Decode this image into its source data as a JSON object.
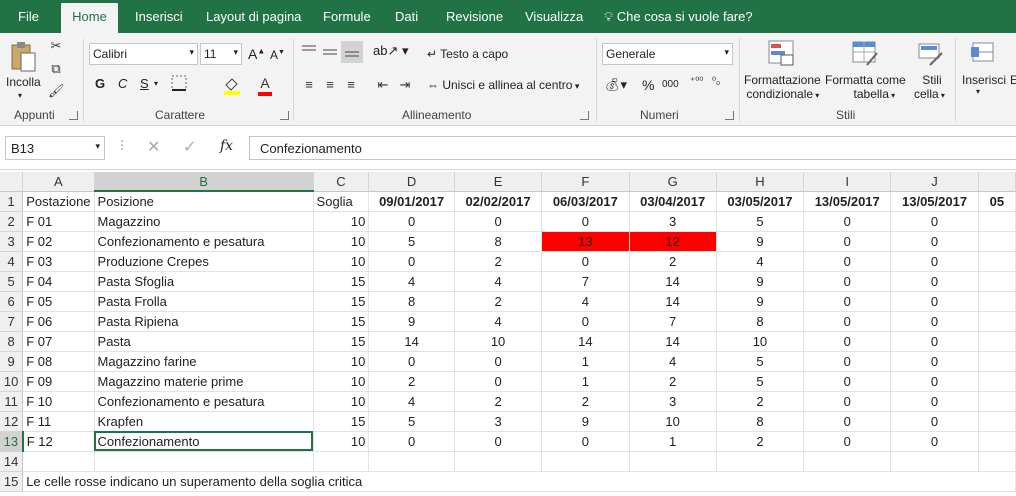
{
  "tabs": [
    "File",
    "Home",
    "Inserisci",
    "Layout di pagina",
    "Formule",
    "Dati",
    "Revisione",
    "Visualizza"
  ],
  "tell_me": "Che cosa si vuole fare?",
  "ribbon": {
    "clipboard": {
      "paste_label": "Incolla",
      "group": "Appunti"
    },
    "font": {
      "name": "Calibri",
      "size": "11",
      "bold": "G",
      "italic": "C",
      "underline": "S",
      "grow": "A",
      "shrink": "A",
      "group": "Carattere"
    },
    "alignment": {
      "wrap": "Testo a capo",
      "merge": "Unisci e allinea al centro",
      "group": "Allineamento"
    },
    "number": {
      "format": "Generale",
      "percent": "%",
      "thousands": "000",
      "dec_inc": "⁺⁰⁰",
      "dec_dec": "⁰₀",
      "group": "Numeri"
    },
    "styles": {
      "cond_format_1": "Formattazione",
      "cond_format_2": "condizionale",
      "table_format_1": "Formatta come",
      "table_format_2": "tabella",
      "cell_styles_1": "Stili",
      "cell_styles_2": "cella",
      "group": "Stili"
    },
    "cells": {
      "insert": "Inserisci"
    }
  },
  "formula_bar": {
    "name_box": "B13",
    "fx": "fx",
    "content": "Confezionamento"
  },
  "colors": {
    "accent": "#217346",
    "alert": "#ff0000"
  },
  "sheet": {
    "columns": [
      "A",
      "B",
      "C",
      "D",
      "E",
      "F",
      "G",
      "H",
      "I",
      "J",
      ""
    ],
    "selected_col": "B",
    "selected_row": 13,
    "header": [
      "Postazione",
      "Posizione",
      "Soglia",
      "09/01/2017",
      "02/02/2017",
      "06/03/2017",
      "03/04/2017",
      "03/05/2017",
      "13/05/2017",
      "13/05/2017",
      "05"
    ],
    "rows": [
      [
        "F 01",
        "Magazzino",
        "10",
        "0",
        "0",
        "0",
        "3",
        "5",
        "0",
        "0"
      ],
      [
        "F 02",
        "Confezionamento e pesatura",
        "10",
        "5",
        "8",
        "13",
        "12",
        "9",
        "0",
        "0"
      ],
      [
        "F 03",
        "Produzione Crepes",
        "10",
        "0",
        "2",
        "0",
        "2",
        "4",
        "0",
        "0"
      ],
      [
        "F 04",
        "Pasta Sfoglia",
        "15",
        "4",
        "4",
        "7",
        "14",
        "9",
        "0",
        "0"
      ],
      [
        "F 05",
        "Pasta Frolla",
        "15",
        "8",
        "2",
        "4",
        "14",
        "9",
        "0",
        "0"
      ],
      [
        "F 06",
        "Pasta Ripiena",
        "15",
        "9",
        "4",
        "0",
        "7",
        "8",
        "0",
        "0"
      ],
      [
        "F 07",
        "Pasta",
        "15",
        "14",
        "10",
        "14",
        "14",
        "10",
        "0",
        "0"
      ],
      [
        "F 08",
        "Magazzino farine",
        "10",
        "0",
        "0",
        "1",
        "4",
        "5",
        "0",
        "0"
      ],
      [
        "F 09",
        "Magazzino materie prime",
        "10",
        "2",
        "0",
        "1",
        "2",
        "5",
        "0",
        "0"
      ],
      [
        "F 10",
        "Confezionamento e pesatura",
        "10",
        "4",
        "2",
        "2",
        "3",
        "2",
        "0",
        "0"
      ],
      [
        "F 11",
        "Krapfen",
        "15",
        "5",
        "3",
        "9",
        "10",
        "8",
        "0",
        "0"
      ],
      [
        "F 12",
        "Confezionamento",
        "10",
        "0",
        "0",
        "0",
        "1",
        "2",
        "0",
        "0"
      ]
    ],
    "red_cells": [
      [
        1,
        5
      ],
      [
        1,
        6
      ]
    ],
    "note": "Le celle rosse indicano un superamento della soglia critica"
  }
}
